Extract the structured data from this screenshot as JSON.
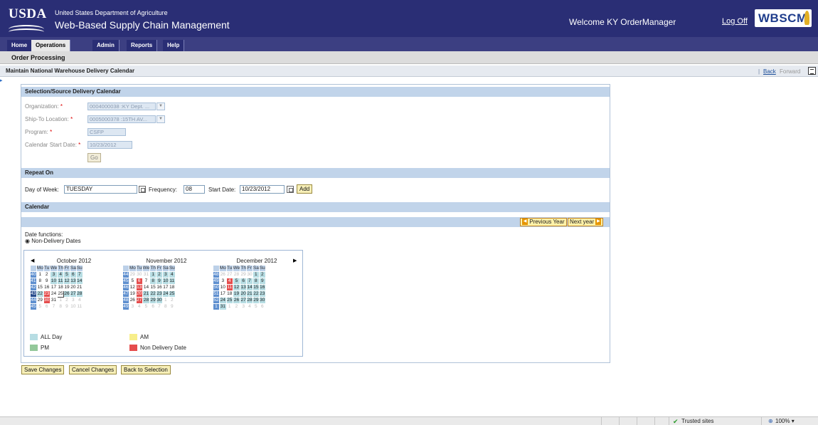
{
  "header": {
    "logo": "USDA",
    "department": "United States Department of Agriculture",
    "system": "Web-Based Supply Chain Management",
    "welcome": "Welcome KY OrderManager",
    "logoff": "Log Off",
    "brand": "WBSCM"
  },
  "nav": {
    "tabs": [
      "Home",
      "Operations",
      "Admin",
      "Reports",
      "Help"
    ],
    "active": "Operations",
    "sub": "Order Processing"
  },
  "titlebar": {
    "title": "Maintain National Warehouse Delivery Calendar",
    "sep": "|",
    "back": "Back",
    "forward": "Forward"
  },
  "selection": {
    "header": "Selection/Source Delivery Calendar",
    "org_label": "Organization:",
    "org_value": "0004000038 :KY Dept. ...",
    "ship_label": "Ship-To Location:",
    "ship_value": "0005000378 :15TH AV...",
    "program_label": "Program:",
    "program_value": "CSFP",
    "start_label": "Calendar Start Date:",
    "start_value": "10/23/2012",
    "req": "*",
    "go": "Go"
  },
  "repeat": {
    "header": "Repeat On",
    "dow_label": "Day of Week:",
    "dow_value": "TUESDAY",
    "freq_label": "Frequency:",
    "freq_value": "08",
    "start_label": "Start Date:",
    "start_value": "10/23/2012",
    "add": "Add"
  },
  "calendar": {
    "header": "Calendar",
    "prev_year": "Previous Year",
    "next_year": "Next year",
    "date_functions": "Date functions:",
    "option": "Non-Delivery Dates",
    "weekday_headers": [
      "Mo",
      "Tu",
      "We",
      "Th",
      "Fr",
      "Sa",
      "Su"
    ],
    "months": [
      {
        "title": "October 2012",
        "weeks": [
          {
            "wk": "40",
            "days": [
              "1",
              "2",
              "3",
              "4",
              "5",
              "6",
              "7"
            ],
            "cls": [
              "wh",
              "wh",
              "all",
              "all",
              "all",
              "all",
              "all"
            ]
          },
          {
            "wk": "41",
            "days": [
              "8",
              "9",
              "10",
              "11",
              "12",
              "13",
              "14"
            ],
            "cls": [
              "wh",
              "wh",
              "all",
              "all",
              "all",
              "all",
              "all"
            ]
          },
          {
            "wk": "42",
            "days": [
              "15",
              "16",
              "17",
              "18",
              "19",
              "20",
              "21"
            ],
            "cls": [
              "wh",
              "wh",
              "wh",
              "wh",
              "wh",
              "wh",
              "wh"
            ]
          },
          {
            "wk": "43",
            "days": [
              "22",
              "23",
              "24",
              "25",
              "26",
              "27",
              "28"
            ],
            "cls": [
              "all",
              "nd",
              "wh",
              "today",
              "all",
              "all",
              "all"
            ],
            "cur": true
          },
          {
            "wk": "44",
            "days": [
              "29",
              "30",
              "31",
              "1",
              "2",
              "3",
              "4"
            ],
            "cls": [
              "wh",
              "nd",
              "wh",
              "out",
              "out",
              "out",
              "out"
            ]
          },
          {
            "wk": "45",
            "days": [
              "5",
              "6",
              "7",
              "8",
              "9",
              "10",
              "11"
            ],
            "cls": [
              "out",
              "out",
              "out",
              "out",
              "out",
              "out",
              "out"
            ]
          }
        ]
      },
      {
        "title": "November 2012",
        "weeks": [
          {
            "wk": "44",
            "days": [
              "29",
              "30",
              "31",
              "1",
              "2",
              "3",
              "4"
            ],
            "cls": [
              "out",
              "out",
              "out",
              "all",
              "all",
              "all",
              "all"
            ]
          },
          {
            "wk": "45",
            "days": [
              "5",
              "6",
              "7",
              "8",
              "9",
              "10",
              "11"
            ],
            "cls": [
              "wh",
              "nd",
              "wh",
              "all",
              "all",
              "all",
              "all"
            ]
          },
          {
            "wk": "46",
            "days": [
              "12",
              "13",
              "14",
              "15",
              "16",
              "17",
              "18"
            ],
            "cls": [
              "wh",
              "nd",
              "wh",
              "wh",
              "wh",
              "wh",
              "wh"
            ]
          },
          {
            "wk": "47",
            "days": [
              "19",
              "20",
              "21",
              "22",
              "23",
              "24",
              "25"
            ],
            "cls": [
              "wh",
              "nd",
              "all",
              "all",
              "all",
              "all",
              "all"
            ]
          },
          {
            "wk": "48",
            "days": [
              "26",
              "27",
              "28",
              "29",
              "30",
              "1",
              "2"
            ],
            "cls": [
              "wh",
              "nd",
              "all",
              "all",
              "all",
              "out",
              "out"
            ]
          },
          {
            "wk": "49",
            "days": [
              "3",
              "4",
              "5",
              "6",
              "7",
              "8",
              "9"
            ],
            "cls": [
              "out",
              "out",
              "out",
              "out",
              "out",
              "out",
              "out"
            ]
          }
        ]
      },
      {
        "title": "December 2012",
        "weeks": [
          {
            "wk": "48",
            "days": [
              "26",
              "27",
              "28",
              "29",
              "30",
              "1",
              "2"
            ],
            "cls": [
              "out",
              "out",
              "out",
              "out",
              "out",
              "all",
              "all"
            ]
          },
          {
            "wk": "49",
            "days": [
              "3",
              "4",
              "5",
              "6",
              "7",
              "8",
              "9"
            ],
            "cls": [
              "wh",
              "nd",
              "all",
              "all",
              "all",
              "all",
              "all"
            ]
          },
          {
            "wk": "50",
            "days": [
              "10",
              "11",
              "12",
              "13",
              "14",
              "15",
              "16"
            ],
            "cls": [
              "wh",
              "nd",
              "all",
              "all",
              "all",
              "all",
              "all"
            ]
          },
          {
            "wk": "51",
            "days": [
              "17",
              "18",
              "19",
              "20",
              "21",
              "22",
              "23"
            ],
            "cls": [
              "wh",
              "wh",
              "all",
              "all",
              "all",
              "all",
              "all"
            ]
          },
          {
            "wk": "52",
            "days": [
              "24",
              "25",
              "26",
              "27",
              "28",
              "29",
              "30"
            ],
            "cls": [
              "all",
              "all",
              "all",
              "all",
              "all",
              "all",
              "all"
            ]
          },
          {
            "wk": "1",
            "days": [
              "31",
              "1",
              "2",
              "3",
              "4",
              "5",
              "6"
            ],
            "cls": [
              "all",
              "out",
              "out",
              "out",
              "out",
              "out",
              "out"
            ]
          }
        ]
      }
    ],
    "legend": {
      "all_day": "ALL Day",
      "am": "AM",
      "pm": "PM",
      "non_delivery": "Non Delivery Date"
    },
    "colors": {
      "all_day": "#b7dde3",
      "am": "#f7ee8a",
      "pm": "#93c89a",
      "non_delivery": "#e54d4d"
    }
  },
  "actions": {
    "save": "Save Changes",
    "cancel": "Cancel Changes",
    "back": "Back to Selection"
  },
  "status": {
    "trusted": "Trusted sites",
    "zoom": "100%"
  }
}
